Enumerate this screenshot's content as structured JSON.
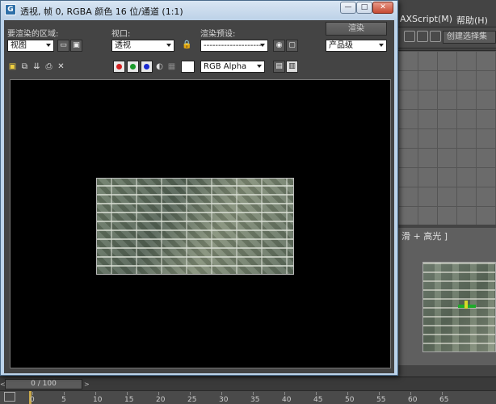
{
  "main_window": {
    "menu": {
      "maxscript": "AXScript(M)",
      "help": "帮助(H)"
    },
    "selection_set_field": "创建选择集",
    "viewport_label": "滑 + 高光 ]",
    "timeline": {
      "slider_text": "0 / 100",
      "prev": "<",
      "next": ">"
    },
    "track_ticks": [
      "0",
      "5",
      "10",
      "15",
      "20",
      "25",
      "30",
      "35",
      "40",
      "45",
      "50",
      "55",
      "60",
      "65"
    ]
  },
  "render_frame_window": {
    "title": "透视, 帧 0, RGBA 颜色 16 位/通道 (1:1)",
    "app_icon_glyph": "G",
    "buttons": {
      "minimize": "—",
      "maximize": "□",
      "close": "✕"
    },
    "area_to_render": {
      "label": "要渲染的区域:",
      "value": "视图"
    },
    "viewport": {
      "label": "视口:",
      "value": "透视"
    },
    "render_preset": {
      "label": "渲染预设:",
      "value": "--------------------"
    },
    "render_button": "渲染",
    "production_level": "产品级",
    "channel_display": "RGB Alpha",
    "colors": {
      "red_channel": "#d42020",
      "green_channel": "#1a9a2a",
      "blue_channel": "#1a2ad0",
      "frame_background": "#000000",
      "window_chrome": "#bcd3ea"
    },
    "icons": {
      "save": "save-icon",
      "copy": "copy-icon",
      "clone": "clone-icon",
      "print": "print-icon",
      "clear": "clear-icon",
      "lock": "lock-icon",
      "hand": "pan-icon"
    },
    "toolbar_glyphs": {
      "save": "▣",
      "copy": "⧉",
      "clone": "⇊",
      "print": "⎙",
      "clear": "✕",
      "mono": "◐",
      "cancel": "▦",
      "lock": "🔒",
      "hand": "✋",
      "frame": "▢",
      "teapot": "◉",
      "show_display": "▤",
      "toggle_ui": "▥"
    }
  }
}
